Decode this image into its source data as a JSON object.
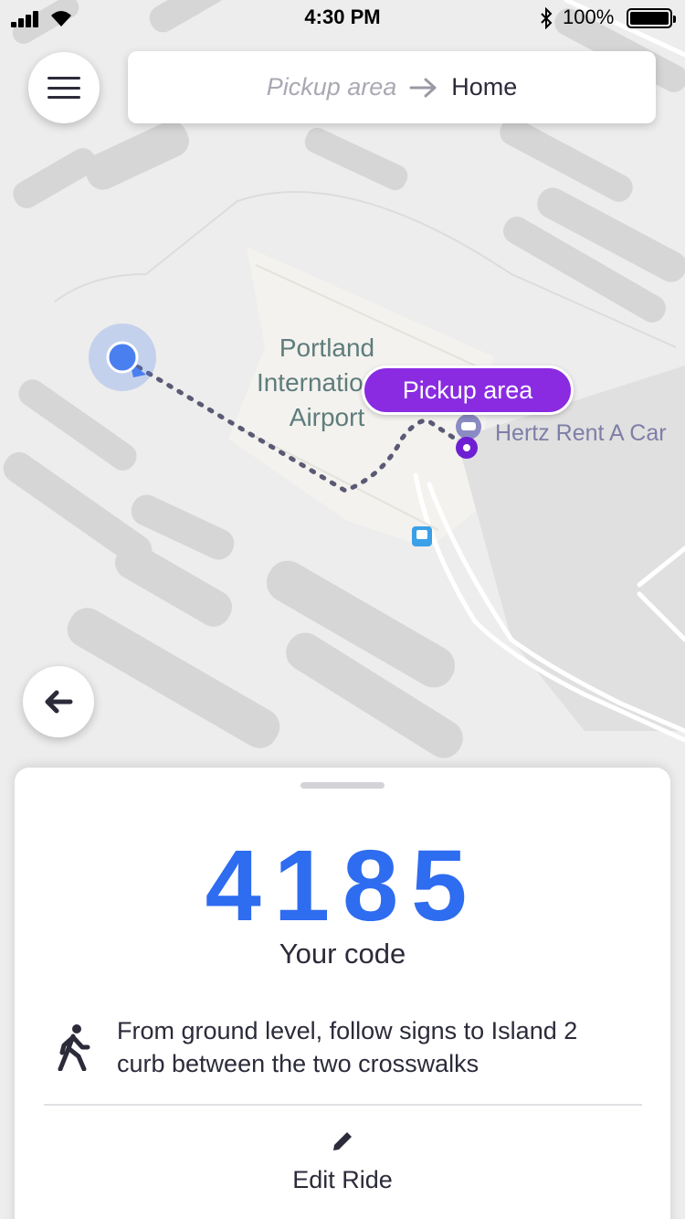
{
  "status_bar": {
    "time": "4:30 PM",
    "battery_percent": "100%",
    "icons": [
      "signal-icon",
      "wifi-icon",
      "bluetooth-icon",
      "battery-icon"
    ]
  },
  "route": {
    "from": "Pickup area",
    "to": "Home"
  },
  "map": {
    "airport_label_lines": [
      "Portland",
      "International",
      "Airport"
    ],
    "poi_label": "Hertz Rent A Car",
    "pickup_bubble": "Pickup area"
  },
  "sheet": {
    "code": "4185",
    "code_label": "Your code",
    "instructions": "From ground level, follow signs to Island 2 curb between the two crosswalks",
    "edit_label": "Edit Ride"
  },
  "colors": {
    "accent_blue": "#2e6cf0",
    "pickup_purple": "#8a2be2",
    "user_location": "#4a7ff0"
  }
}
